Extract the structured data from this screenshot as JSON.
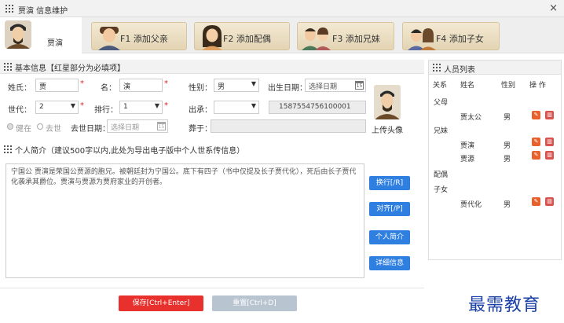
{
  "window": {
    "title": "贾演 信息维护",
    "close_label": "×"
  },
  "person": {
    "name": "贾演"
  },
  "relations": [
    {
      "label": "F1 添加父亲"
    },
    {
      "label": "F2 添加配偶"
    },
    {
      "label": "F3 添加兄妹"
    },
    {
      "label": "F4 添加子女"
    }
  ],
  "basic": {
    "title": "基本信息【红星部分为必填项】",
    "surname_label": "姓氏：",
    "surname_value": "贾",
    "given_label": "名：",
    "given_value": "演",
    "gender_label": "性别：",
    "gender_value": "男",
    "birth_label": "出生日期：",
    "birth_placeholder": "选择日期",
    "gen_label": "世代：",
    "gen_value": "2",
    "rank_label": "排行：",
    "rank_value": "1",
    "succession_label": "出承：",
    "succession_value": "",
    "code_value": "1587554756100001",
    "alive_label": "健在",
    "dead_label": "去世",
    "death_label": "去世日期：",
    "death_placeholder": "选择日期",
    "burial_label": "葬于：",
    "required_mark": "*",
    "upload_label": "上传头像"
  },
  "bio": {
    "title": "个人简介（建议500字以内,此处为导出电子版中个人世系传信息）",
    "text": "宁国公 贾演是荣国公贾源的胞兄。被朝廷封为宁国公。底下有四子（书中仅提及长子贾代化），死后由长子贾代化袭承其爵位。贾演与贾源为贾府家业的开创者。"
  },
  "side_buttons": [
    "换行[/R]",
    "对齐[/P]",
    "个人简介",
    "详细信息"
  ],
  "bottom_buttons": {
    "save": "保存[Ctrl+Enter]",
    "reset": "重置[Ctrl+D]"
  },
  "member_list": {
    "title": "人员列表",
    "columns": [
      "关系",
      "姓名",
      "性别",
      "操 作"
    ],
    "groups": [
      {
        "label": "父母",
        "rows": [
          {
            "name": "贾太公",
            "gender": "男"
          }
        ]
      },
      {
        "label": "兄妹",
        "rows": [
          {
            "name": "贾演",
            "gender": "男"
          },
          {
            "name": "贾源",
            "gender": "男"
          }
        ]
      },
      {
        "label": "配偶",
        "rows": []
      },
      {
        "label": "子女",
        "rows": [
          {
            "name": "贾代化",
            "gender": "男"
          }
        ]
      }
    ]
  },
  "watermark": "最需教育",
  "colors": {
    "accent_blue": "#2e7fe0",
    "save_red": "#e8302c",
    "reset_gray": "#b8c4d0"
  }
}
